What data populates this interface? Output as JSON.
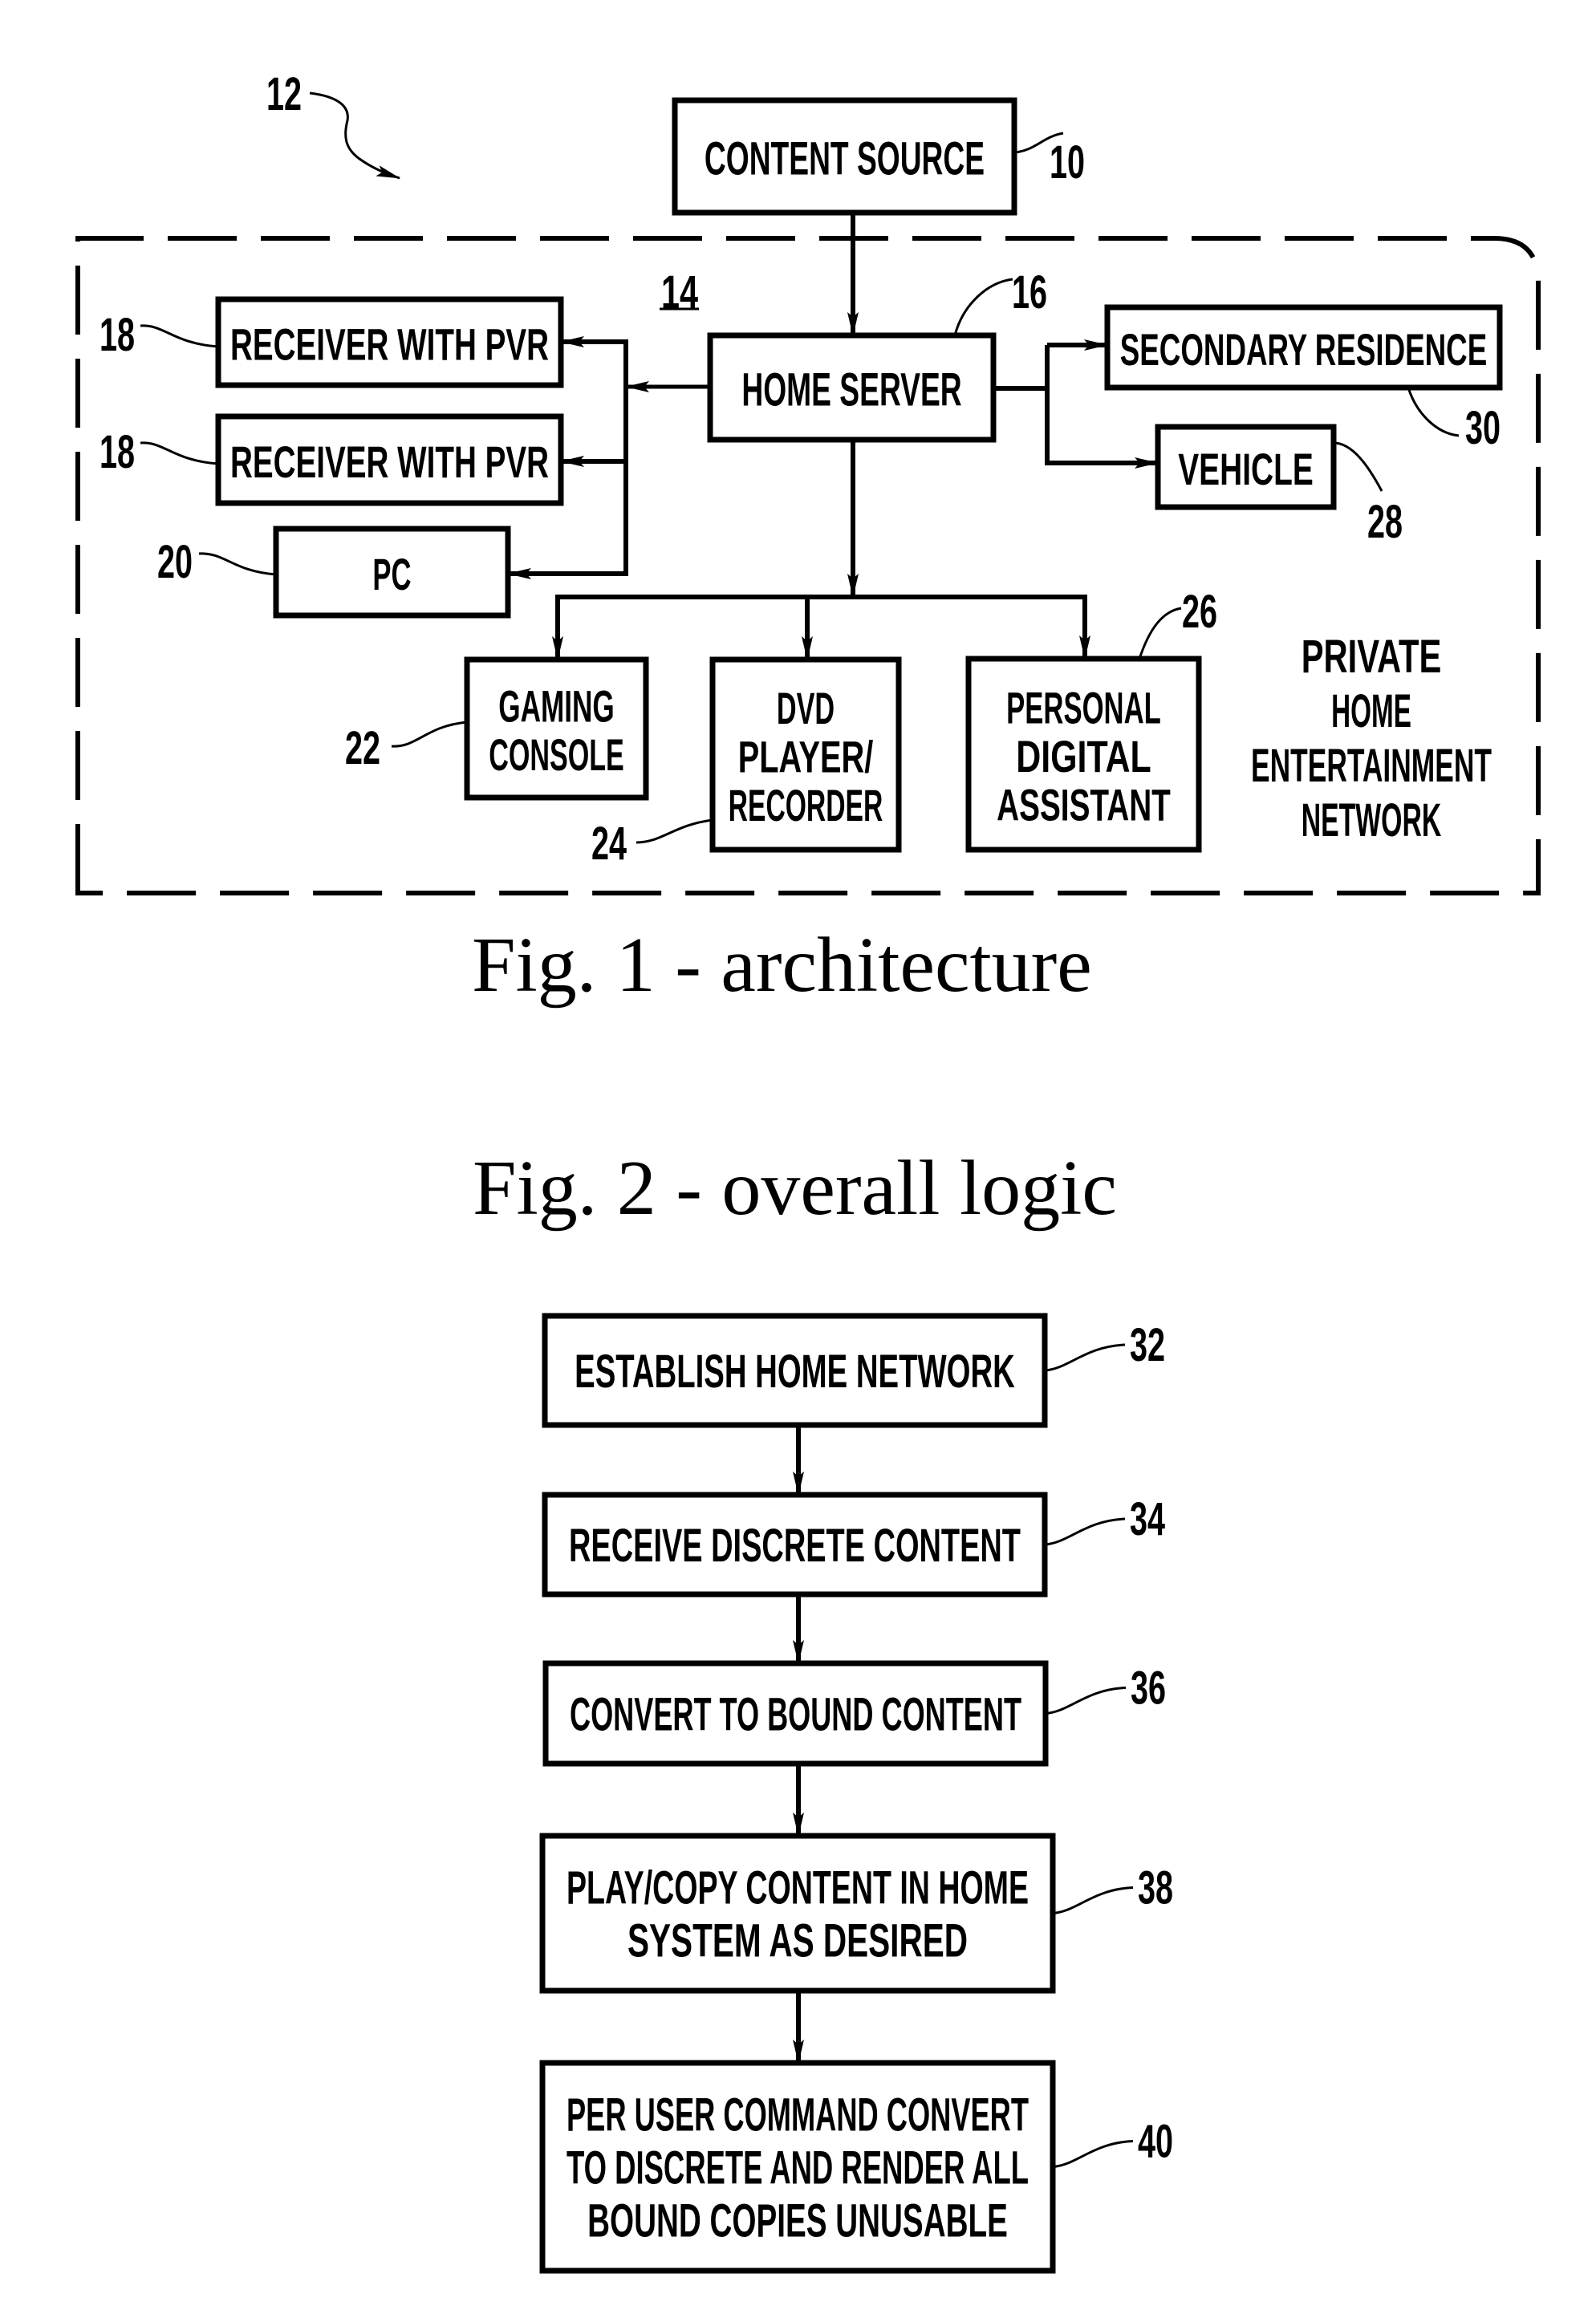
{
  "figure1": {
    "caption": "Fig. 1 - architecture",
    "system_ref": "12",
    "network_ref": "14",
    "network_label": [
      "PRIVATE",
      "HOME",
      "ENTERTAINMENT",
      "NETWORK"
    ],
    "nodes": [
      {
        "id": "content_source",
        "ref": "10",
        "lines": [
          "CONTENT SOURCE"
        ]
      },
      {
        "id": "home_server",
        "ref": "16",
        "lines": [
          "HOME SERVER"
        ]
      },
      {
        "id": "receiver_1",
        "ref": "18",
        "lines": [
          "RECEIVER WITH PVR"
        ]
      },
      {
        "id": "receiver_2",
        "ref": "18",
        "lines": [
          "RECEIVER WITH PVR"
        ]
      },
      {
        "id": "pc",
        "ref": "20",
        "lines": [
          "PC"
        ]
      },
      {
        "id": "gaming_console",
        "ref": "22",
        "lines": [
          "GAMING",
          "CONSOLE"
        ]
      },
      {
        "id": "dvd",
        "ref": "24",
        "lines": [
          "DVD",
          "PLAYER/",
          "RECORDER"
        ]
      },
      {
        "id": "pda",
        "ref": "26",
        "lines": [
          "PERSONAL",
          "DIGITAL",
          "ASSISTANT"
        ]
      },
      {
        "id": "vehicle",
        "ref": "28",
        "lines": [
          "VEHICLE"
        ]
      },
      {
        "id": "secondary_residence",
        "ref": "30",
        "lines": [
          "SECONDARY RESIDENCE"
        ]
      }
    ],
    "edges": [
      {
        "from": "content_source",
        "to": "home_server"
      },
      {
        "from": "home_server",
        "to": "receiver_1"
      },
      {
        "from": "home_server",
        "to": "receiver_2"
      },
      {
        "from": "home_server",
        "to": "pc"
      },
      {
        "from": "home_server",
        "to": "secondary_residence"
      },
      {
        "from": "home_server",
        "to": "vehicle"
      },
      {
        "from": "home_server",
        "to": "gaming_console"
      },
      {
        "from": "home_server",
        "to": "dvd"
      },
      {
        "from": "home_server",
        "to": "pda"
      }
    ]
  },
  "figure2": {
    "caption": "Fig. 2 - overall logic",
    "steps": [
      {
        "ref": "32",
        "lines": [
          "ESTABLISH HOME NETWORK"
        ]
      },
      {
        "ref": "34",
        "lines": [
          "RECEIVE DISCRETE CONTENT"
        ]
      },
      {
        "ref": "36",
        "lines": [
          "CONVERT TO BOUND CONTENT"
        ]
      },
      {
        "ref": "38",
        "lines": [
          "PLAY/COPY CONTENT IN HOME",
          "SYSTEM AS DESIRED"
        ]
      },
      {
        "ref": "40",
        "lines": [
          "PER USER COMMAND CONVERT",
          "TO DISCRETE AND RENDER ALL",
          "BOUND COPIES UNUSABLE"
        ]
      }
    ]
  }
}
